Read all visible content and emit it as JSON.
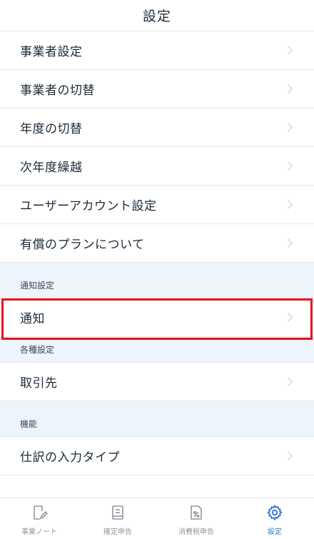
{
  "header": {
    "title": "設定"
  },
  "menu": {
    "items": [
      {
        "label": "事業者設定"
      },
      {
        "label": "事業者の切替"
      },
      {
        "label": "年度の切替"
      },
      {
        "label": "次年度繰越"
      },
      {
        "label": "ユーザーアカウント設定"
      },
      {
        "label": "有償のプランについて"
      }
    ]
  },
  "sections": {
    "notification": {
      "title": "通知設定",
      "items": [
        {
          "label": "通知"
        }
      ]
    },
    "various": {
      "title": "各種設定",
      "items": [
        {
          "label": "取引先"
        }
      ]
    },
    "features": {
      "title": "機能",
      "items": [
        {
          "label": "仕訳の入力タイプ"
        }
      ]
    }
  },
  "tabbar": {
    "tabs": [
      {
        "label": "事業ノート",
        "icon": "note-edit-icon"
      },
      {
        "label": "確定申告",
        "icon": "document-icon"
      },
      {
        "label": "消費税申告",
        "icon": "percent-document-icon"
      },
      {
        "label": "設定",
        "icon": "gear-icon",
        "active": true
      }
    ]
  },
  "colors": {
    "accent": "#2d74d6",
    "highlight": "#e8101c",
    "section_bg": "#eef4fb"
  }
}
